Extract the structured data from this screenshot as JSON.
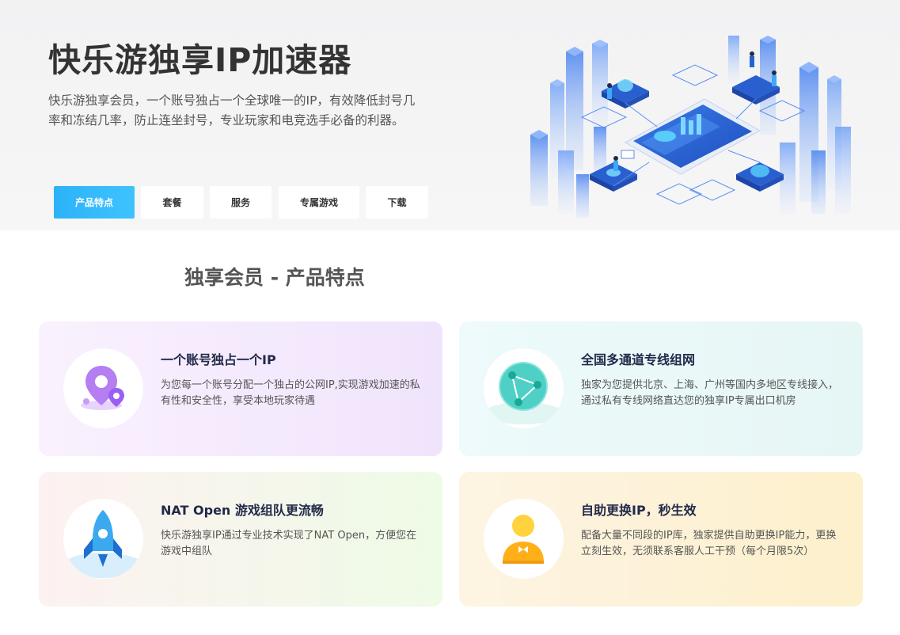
{
  "hero": {
    "title": "快乐游独享IP加速器",
    "description": "快乐游独享会员，一个账号独占一个全球唯一的IP，有效降低封号几率和冻结几率，防止连坐封号，专业玩家和电竞选手必备的利器。"
  },
  "tabs": [
    {
      "label": "产品特点",
      "active": true
    },
    {
      "label": "套餐",
      "active": false
    },
    {
      "label": "服务",
      "active": false
    },
    {
      "label": "专属游戏",
      "active": false
    },
    {
      "label": "下载",
      "active": false
    }
  ],
  "section": {
    "title": "独享会员 - 产品特点"
  },
  "features": [
    {
      "title": "一个账号独占一个IP",
      "text": "为您每一个账号分配一个独占的公网IP,实现游戏加速的私有性和安全性，享受本地玩家待遇",
      "icon": "location-pin-icon"
    },
    {
      "title": "全国多通道专线组网",
      "text": "独家为您提供北京、上海、广州等国内多地区专线接入，通过私有专线网络直达您的独享IP专属出口机房",
      "icon": "globe-network-icon"
    },
    {
      "title": "NAT Open 游戏组队更流畅",
      "text": "快乐游独享IP通过专业技术实现了NAT Open，方便您在游戏中组队",
      "icon": "rocket-icon"
    },
    {
      "title": "自助更换IP，秒生效",
      "text": "配备大量不同段的IP库，独家提供自助更换IP能力，更换立刻生效，无须联系客服人工干预（每个月限5次）",
      "icon": "user-service-icon"
    }
  ],
  "colors": {
    "accent": "#2cb2f8",
    "title_dark": "#222a4a"
  }
}
